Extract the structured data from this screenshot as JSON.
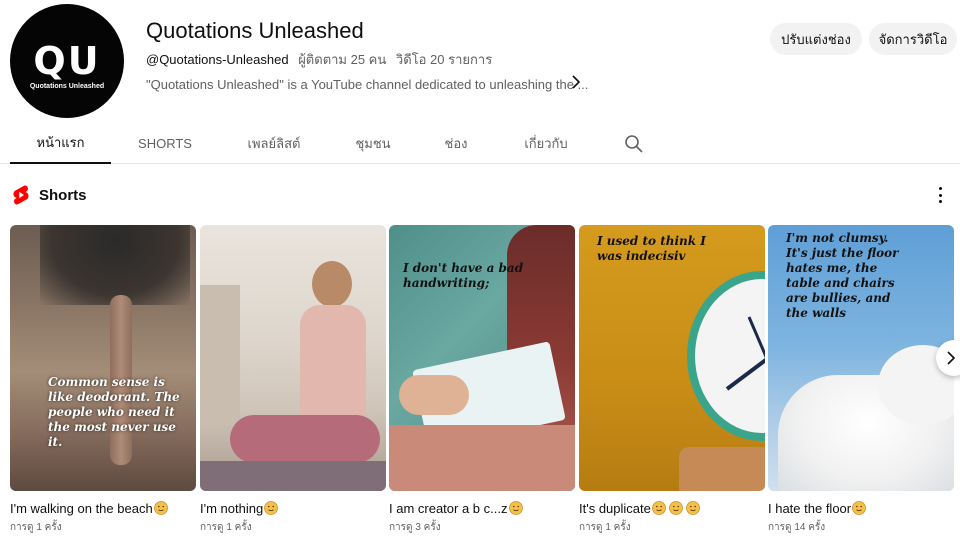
{
  "channel": {
    "avatar_monogram": "QU",
    "avatar_text": "Quotations Unleashed",
    "name": "Quotations Unleashed",
    "handle": "@Quotations-Unleashed",
    "subscribers": "ผู้ติดตาม 25 คน",
    "videos": "วิดีโอ 20 รายการ",
    "description": "\"Quotations Unleashed\" is a YouTube channel dedicated to unleashing the ..."
  },
  "buttons": {
    "customize": "ปรับแต่งช่อง",
    "manage": "จัดการวิดีโอ"
  },
  "tabs": [
    {
      "label": "หน้าแรก",
      "active": true
    },
    {
      "label": "SHORTS",
      "active": false
    },
    {
      "label": "เพลย์ลิสต์",
      "active": false
    },
    {
      "label": "ชุมชน",
      "active": false
    },
    {
      "label": "ช่อง",
      "active": false
    },
    {
      "label": "เกี่ยวกับ",
      "active": false
    }
  ],
  "shorts_section": {
    "title": "Shorts",
    "items": [
      {
        "title": "I'm walking on the beach",
        "views": "การดู 1 ครั้ง",
        "overlay": "Common sense is like deodorant. The people who need it the most never use it.",
        "emoji_count": 1
      },
      {
        "title": "I'm nothing",
        "views": "การดู 1 ครั้ง",
        "overlay": "",
        "emoji_count": 1
      },
      {
        "title": "I am creator a b c...z",
        "views": "การดู 3 ครั้ง",
        "overlay": "I don't have a bad handwriting;",
        "emoji_count": 1
      },
      {
        "title": "It's duplicate",
        "views": "การดู 1 ครั้ง",
        "overlay": "I used to think I was indecisiv",
        "emoji_count": 3
      },
      {
        "title": "I hate the floor",
        "views": "การดู 14 ครั้ง",
        "overlay": "I'm not clumsy. It's just the floor hates me, the table and chairs are bullies, and the walls",
        "emoji_count": 1
      }
    ]
  },
  "icons": {
    "search": "search-icon",
    "shorts_logo": "youtube-shorts-icon",
    "more": "more-vert-icon",
    "next": "chevron-right-icon",
    "emoji": "smiley-emoji-icon"
  },
  "colors": {
    "brand_red": "#ff0000",
    "emoji_yellow": "#f5c04a"
  }
}
